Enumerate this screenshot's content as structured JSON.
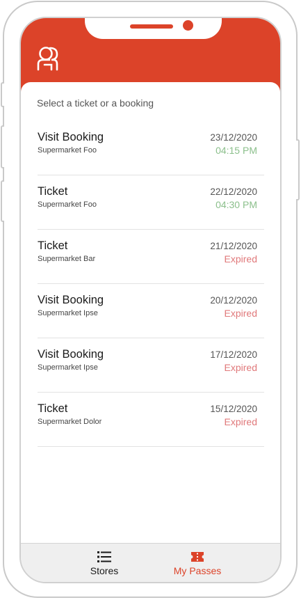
{
  "app": {
    "accent_color": "#dc4329",
    "logo_icon": "user-group-icon"
  },
  "main": {
    "title": "Select a ticket or a booking",
    "items": [
      {
        "name": "Visit Booking",
        "store": "Supermarket Foo",
        "date": "23/12/2020",
        "status": "04:15 PM",
        "status_type": "time"
      },
      {
        "name": "Ticket",
        "store": "Supermarket Foo",
        "date": "22/12/2020",
        "status": "04:30 PM",
        "status_type": "time"
      },
      {
        "name": "Ticket",
        "store": "Supermarket Bar",
        "date": "21/12/2020",
        "status": "Expired",
        "status_type": "expired"
      },
      {
        "name": "Visit Booking",
        "store": "Supermarket Ipse",
        "date": "20/12/2020",
        "status": "Expired",
        "status_type": "expired"
      },
      {
        "name": "Visit Booking",
        "store": "Supermarket Ipse",
        "date": "17/12/2020",
        "status": "Expired",
        "status_type": "expired"
      },
      {
        "name": "Ticket",
        "store": "Supermarket Dolor",
        "date": "15/12/2020",
        "status": "Expired",
        "status_type": "expired"
      }
    ]
  },
  "tabbar": {
    "stores": {
      "label": "Stores",
      "icon": "list-icon"
    },
    "passes": {
      "label": "My Passes",
      "icon": "ticket-icon",
      "active": true
    }
  }
}
